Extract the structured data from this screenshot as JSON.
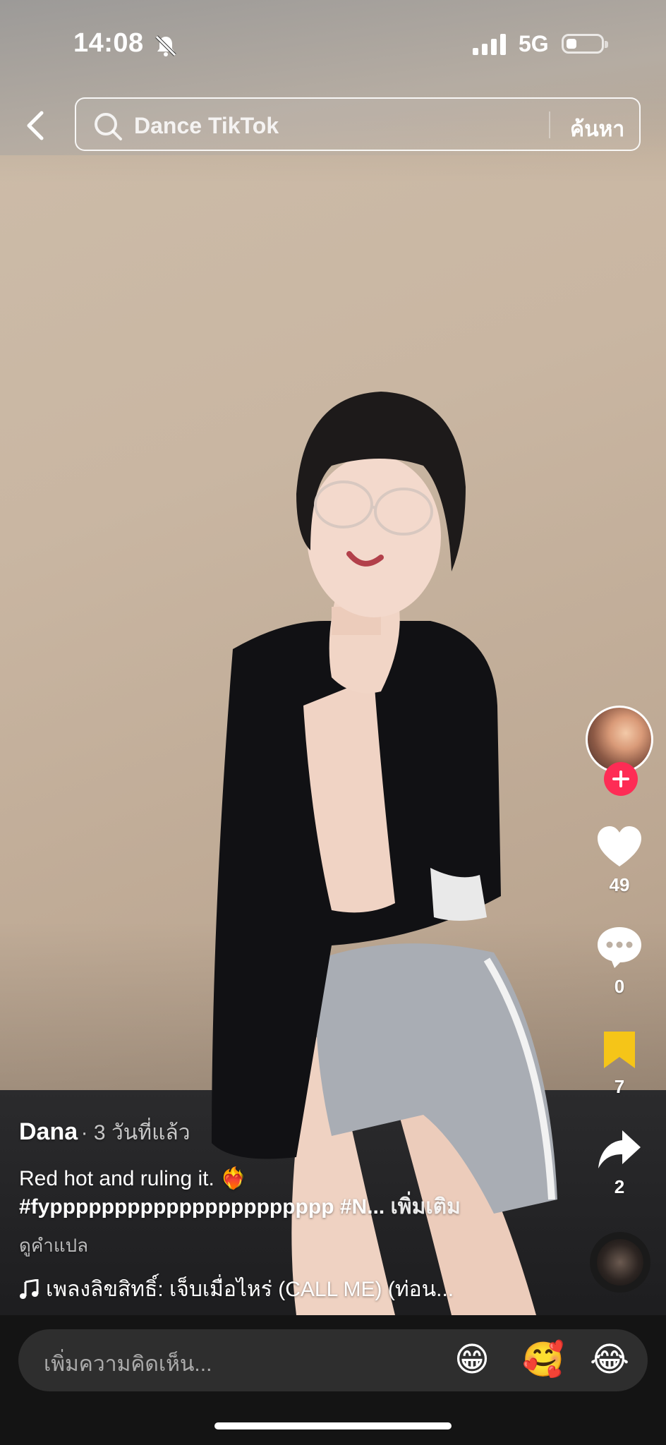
{
  "status": {
    "time": "14:08",
    "network": "5G"
  },
  "search": {
    "query": "Dance TikTok",
    "button": "ค้นหา"
  },
  "actions": {
    "likes": "49",
    "comments": "0",
    "saves": "7",
    "shares": "2"
  },
  "post": {
    "author": "Dana",
    "ago": "· 3 วันที่แล้ว",
    "description": "Red hot and ruling it. ❤️‍🔥",
    "tags": "#fypppppppppppppppppppppp #N...",
    "more": "เพิ่มเติม",
    "translate": "ดูคำแปล",
    "music": "เพลงลิขสิทธิ์: เจ็บเมื่อไหร่ (CALL ME) (ท่อน..."
  },
  "comment": {
    "placeholder": "เพิ่มความคิดเห็น...",
    "emojis": [
      "😁",
      "🥰",
      "😂"
    ]
  },
  "colors": {
    "accent": "#fe2c55",
    "bookmark": "#f5c518"
  }
}
